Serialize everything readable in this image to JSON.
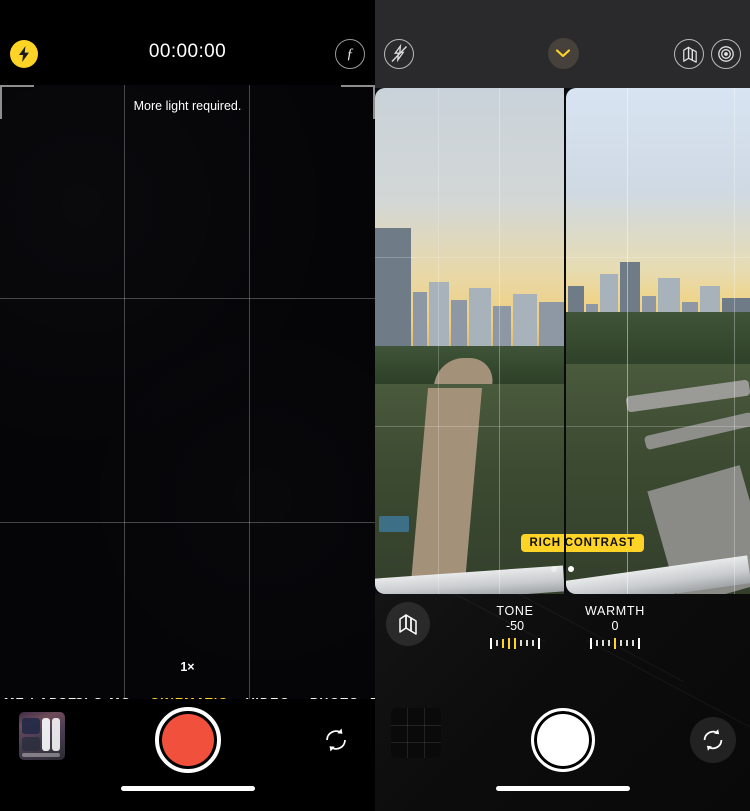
{
  "left_screen": {
    "name": "cinematic-video-capture",
    "status_dot_color": "#30d158",
    "top_bar": {
      "flash_icon": "flash-on-icon",
      "timer": "00:00:00",
      "depth_icon": "f-stop-icon",
      "depth_glyph": "ƒ"
    },
    "viewfinder": {
      "hint": "More light required.",
      "zoom_level": "1×",
      "grid_enabled": true
    },
    "modes": [
      {
        "label": "ME-LAPSE",
        "active": false
      },
      {
        "label": "SLO-MO",
        "active": false
      },
      {
        "label": "CINEMATIC",
        "active": true
      },
      {
        "label": "VIDEO",
        "active": false
      },
      {
        "label": "PHOTO",
        "active": false
      },
      {
        "label": "P",
        "active": false
      }
    ],
    "bottom_bar": {
      "thumbnail_name": "photo-library-thumbnail",
      "shutter_name": "record-button",
      "shutter_color": "#f0503c",
      "flip_icon": "camera-flip-icon"
    },
    "accent_color": "#ffd426"
  },
  "right_screen": {
    "name": "photographic-styles-comparison",
    "status_dot_color": "#30d158",
    "top_bar": {
      "flash_icon": "flash-off-icon",
      "chevron_icon": "chevron-down-icon",
      "chevron_glyph": "⌄",
      "styles_icon": "photographic-styles-icon",
      "depth_icon": "aperture-icon"
    },
    "preview": {
      "style_badge": "RICH CONTRAST",
      "badge_color": "#ffd426",
      "page_dots": 2,
      "active_dot": 1,
      "scene_description": "city skyline with river and highway at sunset"
    },
    "adjustments": [
      {
        "label": "TONE",
        "value": "-50",
        "name": "tone-slider"
      },
      {
        "label": "WARMTH",
        "value": "0",
        "name": "warmth-slider"
      }
    ],
    "bottom_bar": {
      "filters_icon": "photographic-styles-icon",
      "thumbnail_name": "photo-library-thumbnail",
      "shutter_name": "shutter-button",
      "flip_icon": "camera-flip-icon"
    },
    "accent_color": "#ffd426"
  }
}
